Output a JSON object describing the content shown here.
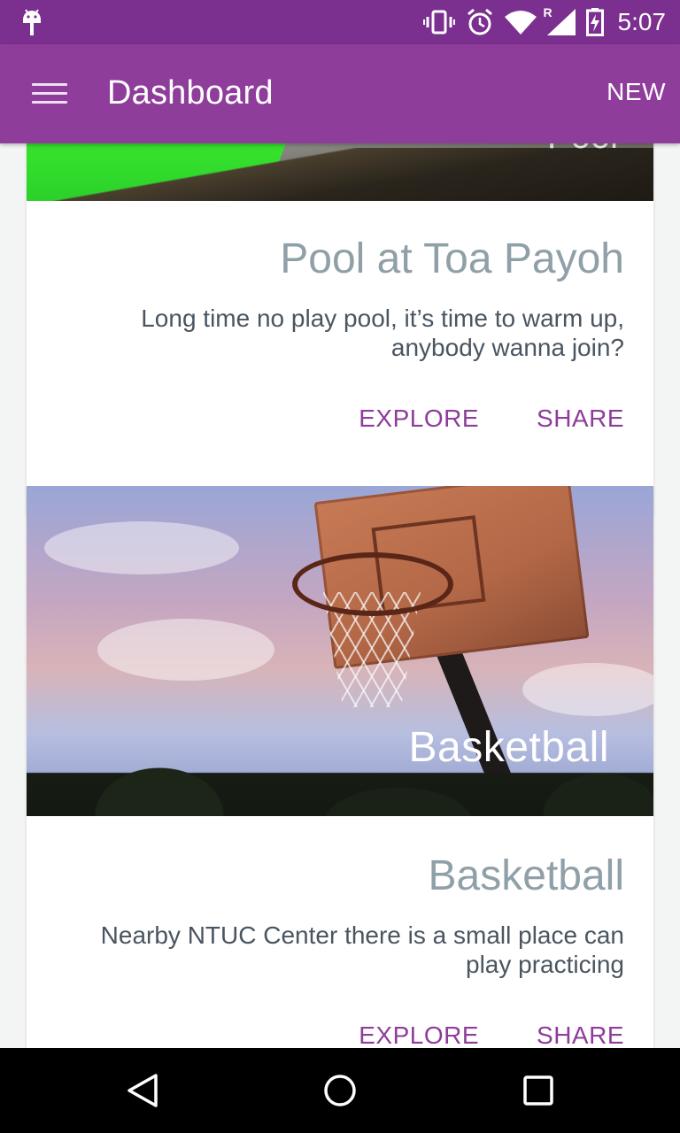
{
  "status_bar": {
    "time": "5:07",
    "network_label": "R",
    "icons": [
      "android-debug-icon",
      "vibrate-icon",
      "alarm-icon",
      "wifi-icon",
      "cellular-signal-icon",
      "battery-charging-icon"
    ]
  },
  "app_bar": {
    "title": "Dashboard",
    "new_label": "NEW",
    "menu_icon": "hamburger-menu-icon"
  },
  "cards": [
    {
      "image_overlay_title": "Pool",
      "title": "Pool at Toa Payoh",
      "description": "Long time no play pool, it’s time to warm up, anybody wanna join?",
      "actions": {
        "explore": "EXPLORE",
        "share": "SHARE"
      }
    },
    {
      "image_overlay_title": "Basketball",
      "title": "Basketball",
      "description": "Nearby NTUC Center there is a small place can play practicing",
      "actions": {
        "explore": "EXPLORE",
        "share": "SHARE"
      }
    }
  ],
  "nav_bar": {
    "icons": [
      "back-triangle-icon",
      "home-circle-icon",
      "recents-square-icon"
    ]
  },
  "colors": {
    "status_bar": "#7b2f8f",
    "app_bar": "#8e3d9a",
    "accent": "#8e3d9a",
    "card_title": "#90a0a8",
    "card_text": "#4a5560",
    "background": "#f3f4f4"
  }
}
